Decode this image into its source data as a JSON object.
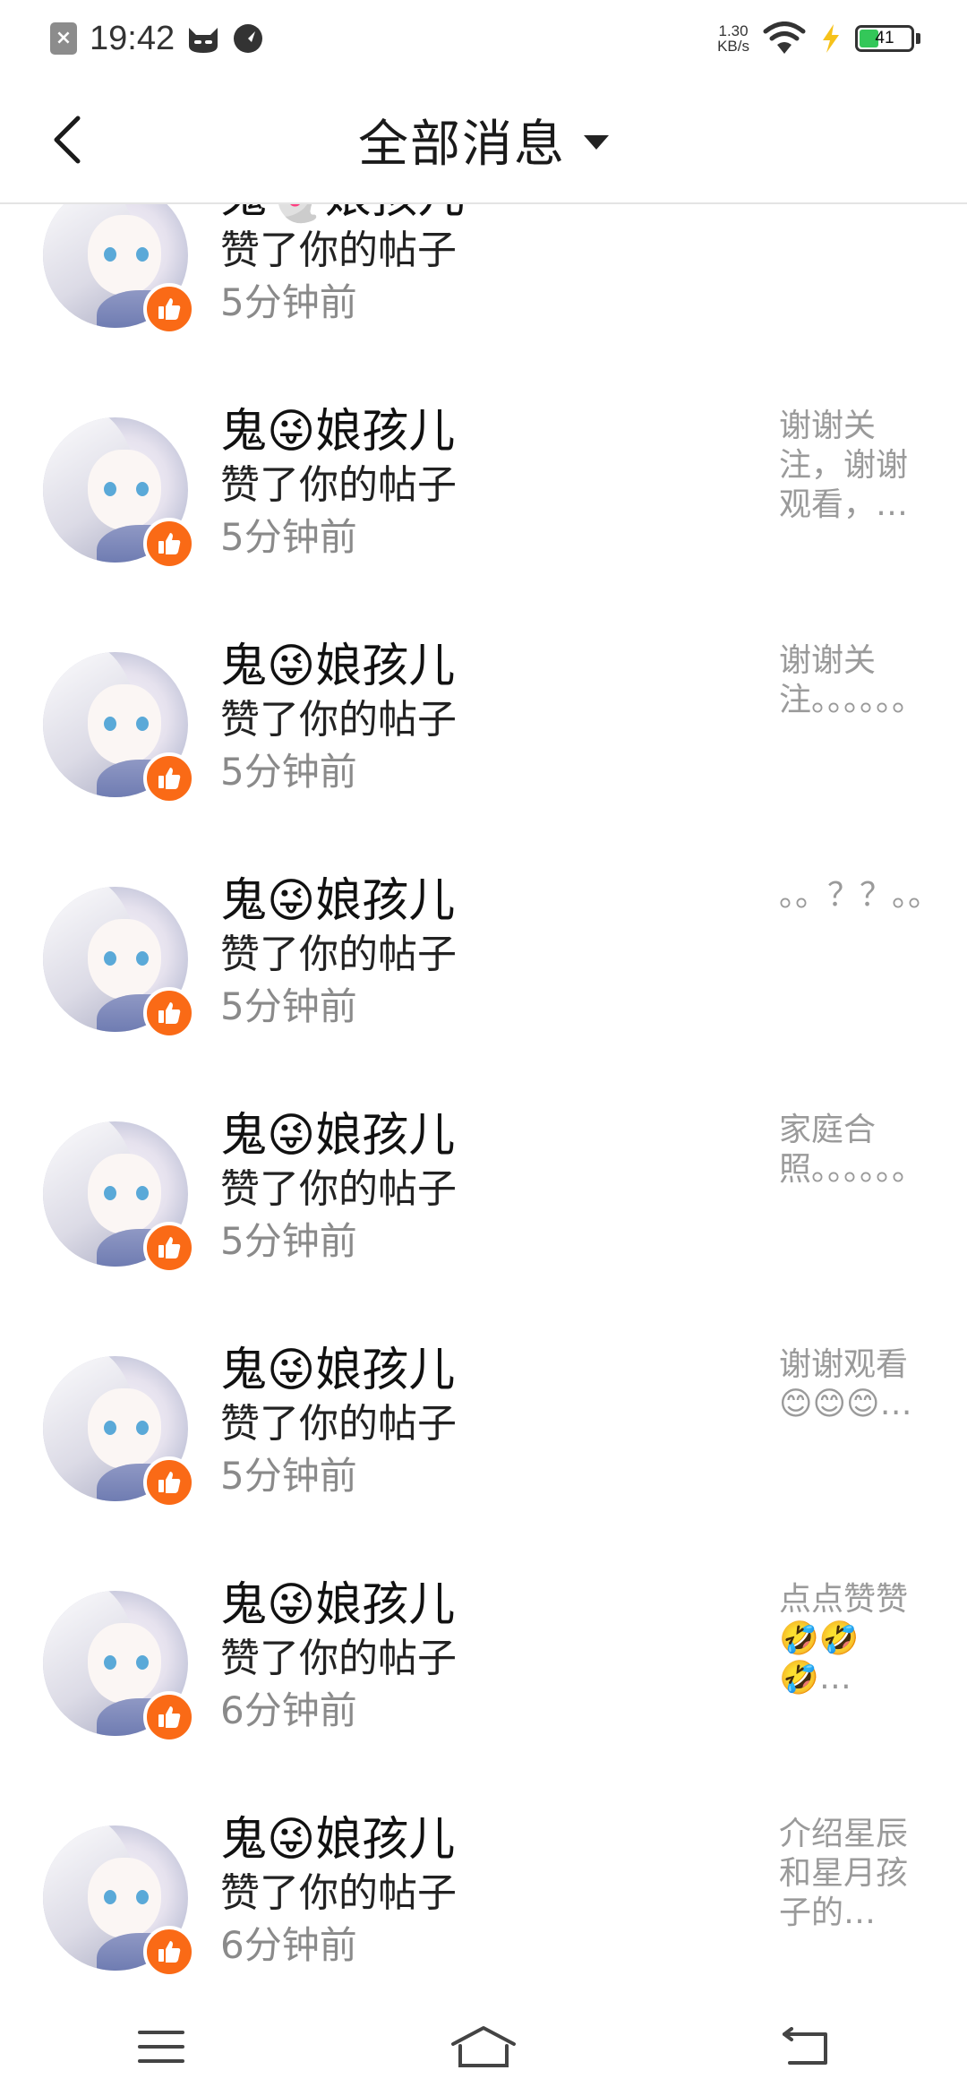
{
  "status_bar": {
    "time": "19:42",
    "net_speed_value": "1.30",
    "net_speed_unit": "KB/s",
    "battery": "41",
    "battery_level": 0.41,
    "battery_color": "#34c759"
  },
  "header": {
    "title": "全部消息",
    "back_icon": "chevron-left-icon",
    "dropdown_icon": "caret-down-icon"
  },
  "accent_color": "#fa6a16",
  "notifications": [
    {
      "name": "鬼👻娘孩儿",
      "action": "赞了你的帖子",
      "time": "5分钟前",
      "preview": "。。。。。。。。。。"
    },
    {
      "name": "鬼😜娘孩儿",
      "action": "赞了你的帖子",
      "time": "5分钟前",
      "preview": "谢谢关注，谢谢观看，…"
    },
    {
      "name": "鬼😜娘孩儿",
      "action": "赞了你的帖子",
      "time": "5分钟前",
      "preview": "谢谢关注。。。。。。…"
    },
    {
      "name": "鬼😜娘孩儿",
      "action": "赞了你的帖子",
      "time": "5分钟前",
      "preview": "。。？？。。。。。。…"
    },
    {
      "name": "鬼😜娘孩儿",
      "action": "赞了你的帖子",
      "time": "5分钟前",
      "preview": "家庭合照。。。。。。…"
    },
    {
      "name": "鬼😜娘孩儿",
      "action": "赞了你的帖子",
      "time": "5分钟前",
      "preview": "谢谢观看😊😊😊…"
    },
    {
      "name": "鬼😜娘孩儿",
      "action": "赞了你的帖子",
      "time": "6分钟前",
      "preview": "点点赞赞🤣🤣🤣…"
    },
    {
      "name": "鬼😜娘孩儿",
      "action": "赞了你的帖子",
      "time": "6分钟前",
      "preview": "介绍星辰和星月孩子的…"
    }
  ],
  "nav_bar": {
    "menu_icon": "menu-icon",
    "home_icon": "home-icon",
    "back_icon": "back-icon"
  }
}
